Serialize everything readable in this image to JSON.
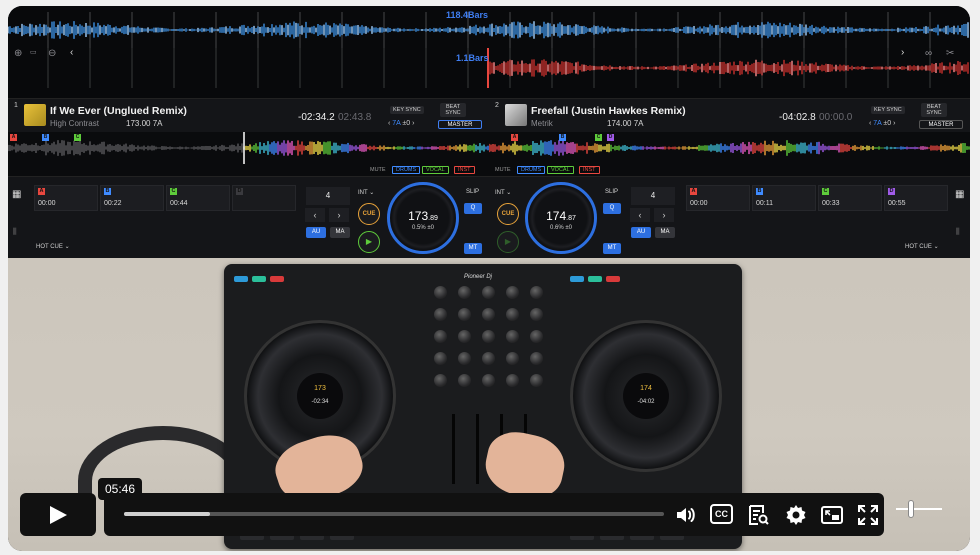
{
  "overview": {
    "bars_top": "118.4Bars",
    "bars_bottom": "1.1Bars",
    "tool_icons": [
      "zoom-in-icon",
      "ruler-icon",
      "zoom-out-icon",
      "chevron-left-icon",
      "chevron-right-icon",
      "link-icon",
      "scissors-icon"
    ]
  },
  "deck1": {
    "number": "1",
    "title": "If We Ever (Unglued Remix)",
    "artist": "High Contrast",
    "bpm_key": "173.00 7A",
    "time_remaining": "-02:34.2",
    "time_elapsed": "02:43.8",
    "key_sync": "KEY SYNC",
    "beat_sync": "BEAT SYNC",
    "key_value": "7A",
    "key_shift": "±0",
    "master": "MASTER",
    "cue_markers": [
      "A",
      "B",
      "C"
    ],
    "stems": [
      "MUTE",
      "DRUMS",
      "VOCAL",
      "INST"
    ],
    "hot_cues": [
      {
        "letter": "A",
        "time": "00:00",
        "color": "#e8473f"
      },
      {
        "letter": "B",
        "time": "00:22",
        "color": "#3f8bff"
      },
      {
        "letter": "C",
        "time": "00:44",
        "color": "#5ecb3b"
      },
      {
        "letter": "D",
        "time": "",
        "color": "#3a3a3e"
      }
    ],
    "hot_cue_label": "HOT CUE",
    "loop_value": "4",
    "int_label": "INT",
    "cue_btn": "CUE",
    "slip": "SLIP",
    "q": "Q",
    "au": "AU",
    "ma": "MA",
    "mt": "MT",
    "jog_bpm_main": "173",
    "jog_bpm_dec": ".89",
    "jog_pitch": "0.5%  ±0"
  },
  "deck2": {
    "number": "2",
    "title": "Freefall (Justin Hawkes Remix)",
    "artist": "Metrik",
    "bpm_key": "174.00 7A",
    "time_remaining": "-04:02.8",
    "time_elapsed": "00:00.0",
    "key_sync": "KEY SYNC",
    "beat_sync": "BEAT SYNC",
    "key_value": "7A",
    "key_shift": "±0",
    "master": "MASTER",
    "cue_markers": [
      "A",
      "B",
      "C",
      "D"
    ],
    "stems": [
      "MUTE",
      "DRUMS",
      "VOCAL",
      "INST"
    ],
    "hot_cues": [
      {
        "letter": "A",
        "time": "00:00",
        "color": "#e8473f"
      },
      {
        "letter": "B",
        "time": "00:11",
        "color": "#3f8bff"
      },
      {
        "letter": "C",
        "time": "00:33",
        "color": "#5ecb3b"
      },
      {
        "letter": "D",
        "time": "00:55",
        "color": "#a05be8"
      }
    ],
    "hot_cue_label": "HOT CUE",
    "loop_value": "4",
    "int_label": "INT",
    "cue_btn": "CUE",
    "slip": "SLIP",
    "q": "Q",
    "au": "AU",
    "ma": "MA",
    "mt": "MT",
    "jog_bpm_main": "174",
    "jog_bpm_dec": ".87",
    "jog_pitch": "0.6%  ±0"
  },
  "hardware": {
    "brand": "Pioneer Dj",
    "left_display_bpm": "173",
    "left_display_time": "-02:34",
    "right_display_bpm": "174",
    "right_display_time": "-04:02"
  },
  "player": {
    "current_time_tooltip": "05:46",
    "progress_fraction": 0.16,
    "volume_fraction": 0.3,
    "icons": [
      "play-icon",
      "volume-icon",
      "captions-icon",
      "transcript-icon",
      "settings-icon",
      "picture-in-picture-icon",
      "fullscreen-icon"
    ],
    "cc_text": "CC"
  },
  "colors": {
    "accent_blue": "#2d6fe0",
    "drums": "#3f8bff",
    "vocal": "#5ecb3b",
    "inst": "#e8473f"
  }
}
